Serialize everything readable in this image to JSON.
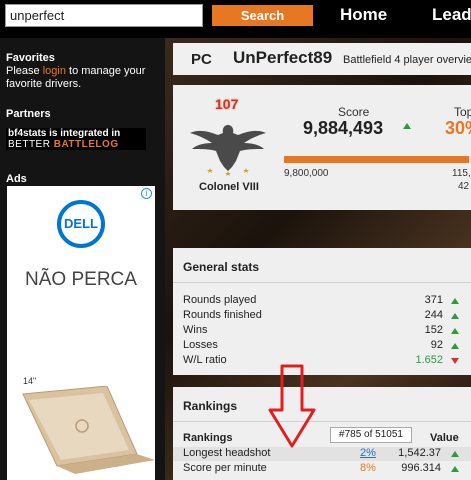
{
  "topbar": {
    "search_value": "unperfect",
    "search_button": "Search",
    "nav": [
      "Home",
      "Lead"
    ]
  },
  "sidebar": {
    "favorites_title": "Favorites",
    "favorites_text_before": "Please ",
    "favorites_link": "login",
    "favorites_text_after": " to manage your favorite drivers.",
    "partners_title": "Partners",
    "partner_line1": "bf4stats is integrated in",
    "partner_line2_a": "BETTER ",
    "partner_line2_b": "BATTLELOG",
    "ads_title": "Ads",
    "ad": {
      "brand": "DELL",
      "headline": "NÃO PERCA",
      "size": "14\""
    }
  },
  "player": {
    "platform": "PC",
    "name": "UnPerfect89",
    "description": "Battlefield 4 player overvie"
  },
  "rank": {
    "number": "107",
    "name": "Colonel VIII",
    "score_label": "Score",
    "score_value": "9,884,493",
    "top_label": "Top",
    "top_value": "30",
    "progress_fraction": 0.99,
    "progress_start": "9,800,000",
    "top_sub1": "115,",
    "top_sub2": "42"
  },
  "general": {
    "title": "General stats",
    "rows": [
      {
        "label": "Rounds played",
        "value": "371",
        "trend": "up"
      },
      {
        "label": "Rounds finished",
        "value": "244",
        "trend": "up"
      },
      {
        "label": "Wins",
        "value": "152",
        "trend": "up"
      },
      {
        "label": "Losses",
        "value": "92",
        "trend": "up"
      },
      {
        "label": "W/L ratio",
        "value": "1.652",
        "trend": "down"
      }
    ]
  },
  "rankings": {
    "title": "Rankings",
    "col_rankings": "Rankings",
    "col_value": "Value",
    "tooltip": "#785 of 51051",
    "rows": [
      {
        "label": "Longest headshot",
        "pct": "2%",
        "value": "1,542.37"
      },
      {
        "label": "Score per minute",
        "pct": "8%",
        "value": "996.314"
      }
    ]
  },
  "colors": {
    "accent": "#e87722",
    "up": "#2e9a3a",
    "down": "#d0342c",
    "annotation_arrow": "#e02020"
  }
}
